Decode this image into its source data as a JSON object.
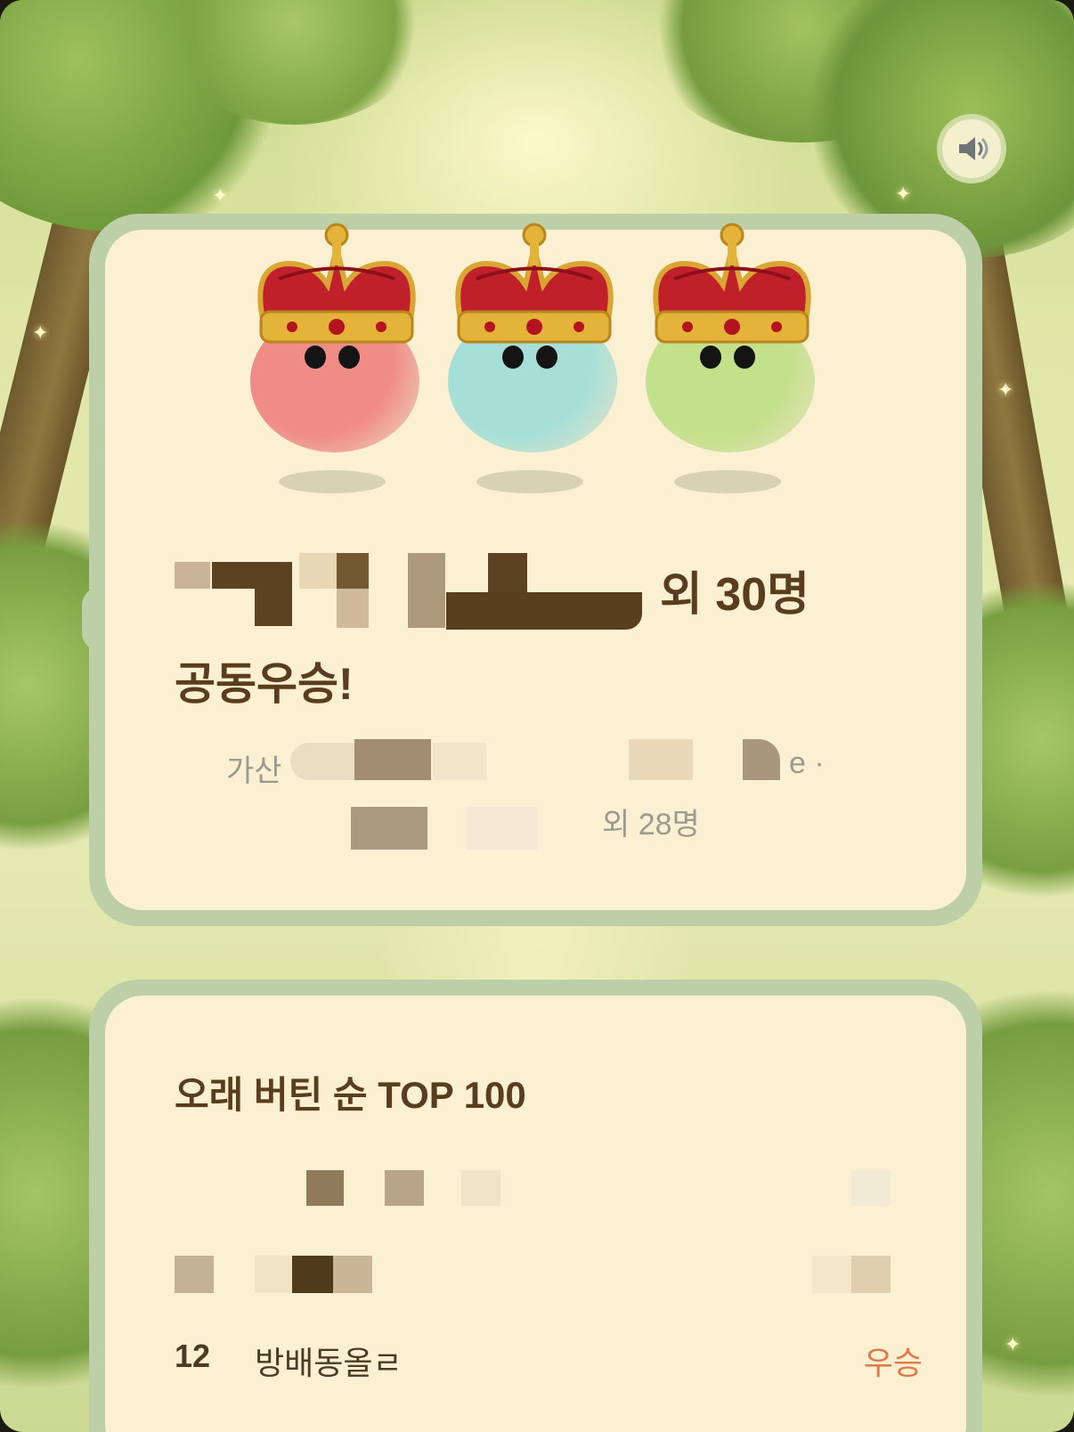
{
  "sound": {
    "icon": "speaker-icon"
  },
  "winner": {
    "count_text": "외 30명",
    "title": "공동우승!",
    "others_line1": "가산",
    "others_line1_end": "e ·",
    "others_line2": "외 28명",
    "characters": [
      {
        "name": "pink",
        "color": "#f08c86"
      },
      {
        "name": "mint",
        "color": "#a6dfd8"
      },
      {
        "name": "lime",
        "color": "#c3e08a"
      }
    ]
  },
  "ranking": {
    "title": "오래 버틴 순 TOP 100",
    "rows": [
      {
        "rank": "12",
        "name": "방배동올ㄹ",
        "badge": "우승"
      }
    ]
  }
}
